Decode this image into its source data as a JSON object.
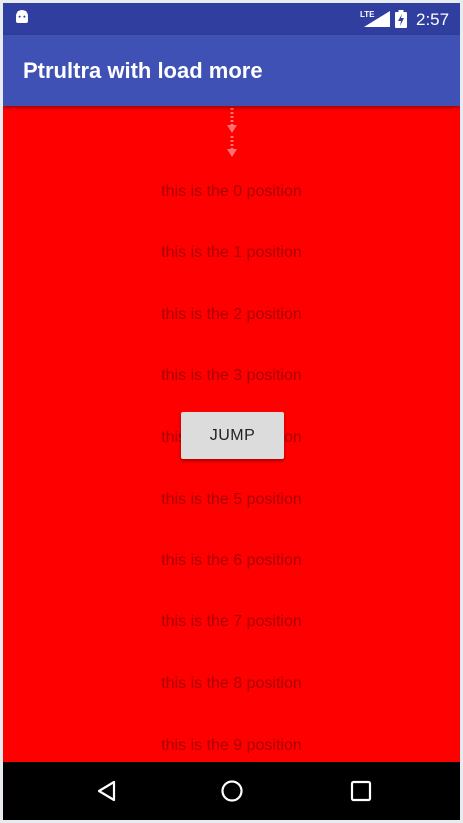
{
  "status_bar": {
    "time": "2:57",
    "network": "LTE",
    "icons": [
      "android-icon",
      "lte-signal-icon",
      "battery-charging-icon"
    ]
  },
  "app_bar": {
    "title": "Ptrultra with load more"
  },
  "refresh_indicator": {
    "icon": "pull-down-arrows-icon"
  },
  "list": {
    "items": [
      "this is the 0 position",
      "this is the 1 position",
      "this is the 2 position",
      "this is the 3 position",
      "this is the 4 position",
      "this is the 5 position",
      "this is the 6 position",
      "this is the 7 position",
      "this is the 8 position",
      "this is the 9 position"
    ]
  },
  "jump_button": {
    "label": "JUMP"
  },
  "nav_bar": {
    "icons": [
      "back-icon",
      "home-icon",
      "recents-icon"
    ]
  },
  "colors": {
    "status_bar": "#303f9f",
    "app_bar": "#3f51b5",
    "list_background": "#ff0000",
    "list_text": "#a80000",
    "button": "#dcdcdc"
  }
}
